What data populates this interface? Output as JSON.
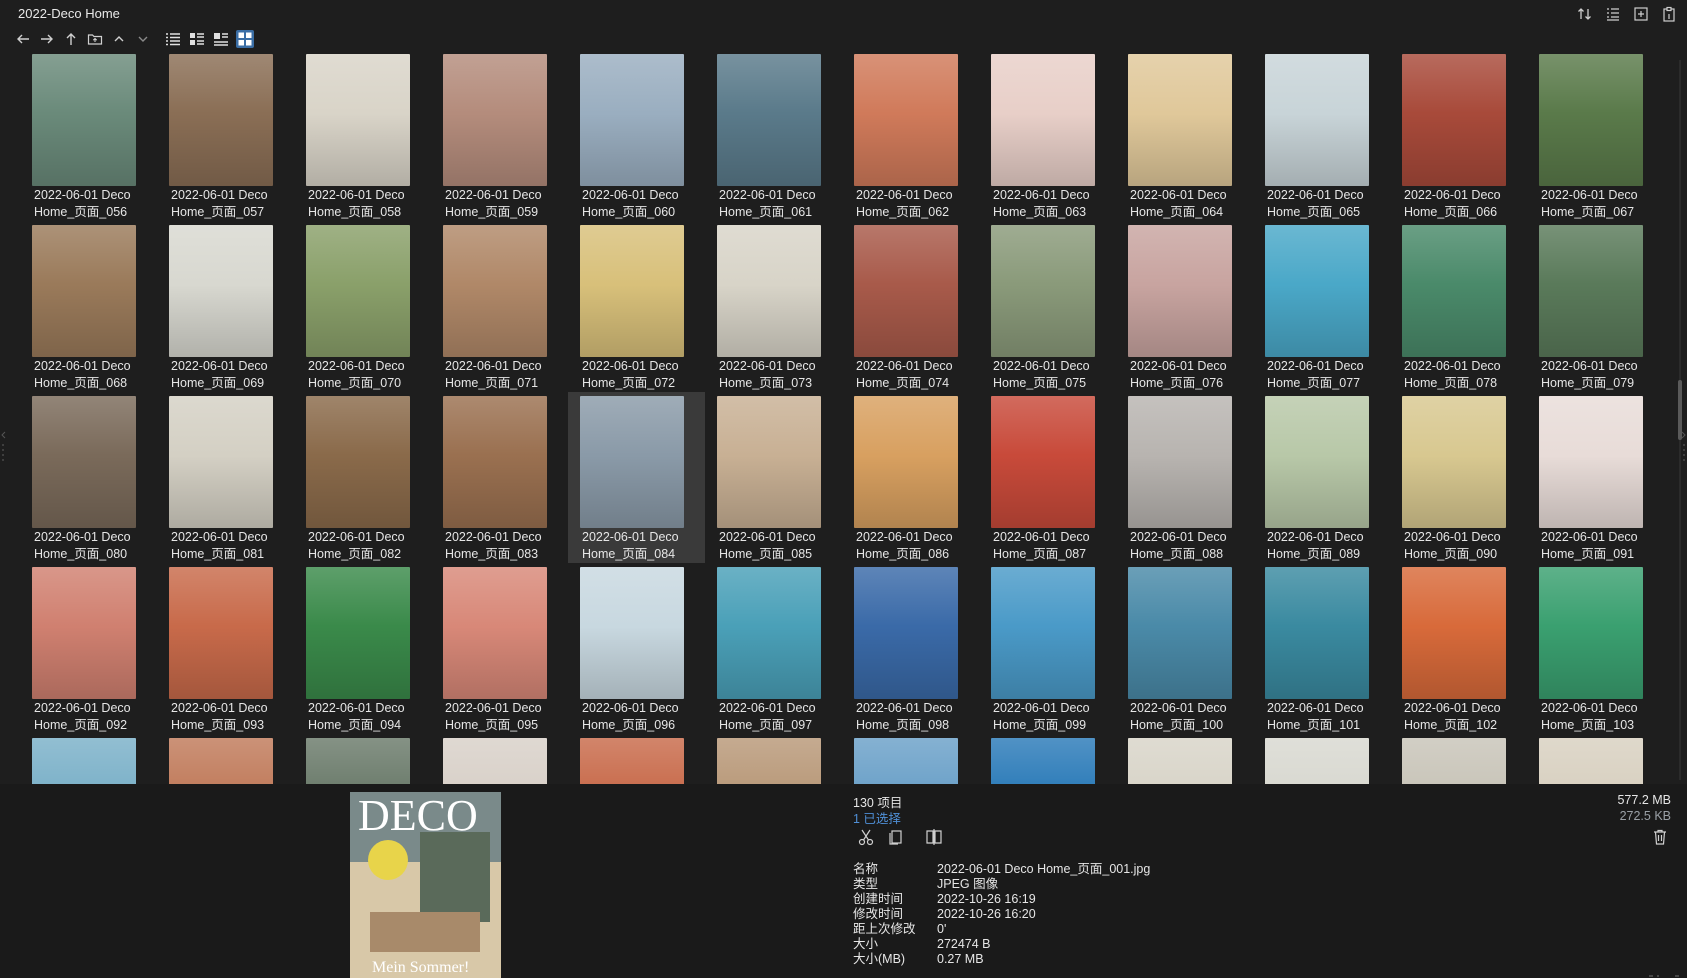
{
  "window": {
    "title": "2022-Deco Home"
  },
  "toolbar": {
    "buttons": [
      {
        "name": "back-icon"
      },
      {
        "name": "forward-icon"
      },
      {
        "name": "up-icon"
      },
      {
        "name": "folder-up-icon"
      },
      {
        "name": "chevron-up-icon"
      },
      {
        "name": "chevron-down-icon"
      },
      {
        "name": "view-list-icon"
      },
      {
        "name": "view-details-icon"
      },
      {
        "name": "view-tiles-icon"
      },
      {
        "name": "view-thumbnails-icon"
      }
    ],
    "active_view": "view-thumbnails-icon"
  },
  "top_right": {
    "icons": [
      "sort-icon",
      "columns-icon",
      "add-pane-icon",
      "clipboard-icon"
    ]
  },
  "grid": {
    "items": [
      {
        "line1": "2022-06-01 Deco",
        "line2": "Home_页面_056",
        "color": "#6a8a7a"
      },
      {
        "line1": "2022-06-01 Deco",
        "line2": "Home_页面_057",
        "color": "#8a6e55"
      },
      {
        "line1": "2022-06-01 Deco",
        "line2": "Home_页面_058",
        "color": "#d9d4c8"
      },
      {
        "line1": "2022-06-01 Deco",
        "line2": "Home_页面_059",
        "color": "#b48c7c"
      },
      {
        "line1": "2022-06-01 Deco",
        "line2": "Home_页面_060",
        "color": "#9aaec0"
      },
      {
        "line1": "2022-06-01 Deco",
        "line2": "Home_页面_061",
        "color": "#5a7a8a"
      },
      {
        "line1": "2022-06-01 Deco",
        "line2": "Home_页面_062",
        "color": "#d07a5a"
      },
      {
        "line1": "2022-06-01 Deco",
        "line2": "Home_页面_063",
        "color": "#e8cfc8"
      },
      {
        "line1": "2022-06-01 Deco",
        "line2": "Home_页面_064",
        "color": "#e0c89a"
      },
      {
        "line1": "2022-06-01 Deco",
        "line2": "Home_页面_065",
        "color": "#c8d4d8"
      },
      {
        "line1": "2022-06-01 Deco",
        "line2": "Home_页面_066",
        "color": "#a84a3a"
      },
      {
        "line1": "2022-06-01 Deco",
        "line2": "Home_页面_067",
        "color": "#5a7a4a"
      },
      {
        "line1": "2022-06-01 Deco",
        "line2": "Home_页面_068",
        "color": "#9a7a5a"
      },
      {
        "line1": "2022-06-01 Deco",
        "line2": "Home_页面_069",
        "color": "#d8d8d0"
      },
      {
        "line1": "2022-06-01 Deco",
        "line2": "Home_页面_070",
        "color": "#8aa06a"
      },
      {
        "line1": "2022-06-01 Deco",
        "line2": "Home_页面_071",
        "color": "#b08868"
      },
      {
        "line1": "2022-06-01 Deco",
        "line2": "Home_页面_072",
        "color": "#d8c07a"
      },
      {
        "line1": "2022-06-01 Deco",
        "line2": "Home_页面_073",
        "color": "#d8d4c8"
      },
      {
        "line1": "2022-06-01 Deco",
        "line2": "Home_页面_074",
        "color": "#a85a4a"
      },
      {
        "line1": "2022-06-01 Deco",
        "line2": "Home_页面_075",
        "color": "#8a9a7a"
      },
      {
        "line1": "2022-06-01 Deco",
        "line2": "Home_页面_076",
        "color": "#c8a4a0"
      },
      {
        "line1": "2022-06-01 Deco",
        "line2": "Home_页面_077",
        "color": "#4aa8c8"
      },
      {
        "line1": "2022-06-01 Deco",
        "line2": "Home_页面_078",
        "color": "#4a8a6a"
      },
      {
        "line1": "2022-06-01 Deco",
        "line2": "Home_页面_079",
        "color": "#5a7a5a"
      },
      {
        "line1": "2022-06-01 Deco",
        "line2": "Home_页面_080",
        "color": "#7a6a5a"
      },
      {
        "line1": "2022-06-01 Deco",
        "line2": "Home_页面_081",
        "color": "#d4d0c4"
      },
      {
        "line1": "2022-06-01 Deco",
        "line2": "Home_页面_082",
        "color": "#8a6a4a"
      },
      {
        "line1": "2022-06-01 Deco",
        "line2": "Home_页面_083",
        "color": "#9a7050"
      },
      {
        "line1": "2022-06-01 Deco",
        "line2": "Home_页面_084",
        "color": "#8a9aa8"
      },
      {
        "line1": "2022-06-01 Deco",
        "line2": "Home_页面_085",
        "color": "#c8b094"
      },
      {
        "line1": "2022-06-01 Deco",
        "line2": "Home_页面_086",
        "color": "#d8a060"
      },
      {
        "line1": "2022-06-01 Deco",
        "line2": "Home_页面_087",
        "color": "#c84a3a"
      },
      {
        "line1": "2022-06-01 Deco",
        "line2": "Home_页面_088",
        "color": "#b8b4b0"
      },
      {
        "line1": "2022-06-01 Deco",
        "line2": "Home_页面_089",
        "color": "#b8c8a8"
      },
      {
        "line1": "2022-06-01 Deco",
        "line2": "Home_页面_090",
        "color": "#d8c890"
      },
      {
        "line1": "2022-06-01 Deco",
        "line2": "Home_页面_091",
        "color": "#e8dcd8"
      },
      {
        "line1": "2022-06-01 Deco",
        "line2": "Home_页面_092",
        "color": "#d08070"
      },
      {
        "line1": "2022-06-01 Deco",
        "line2": "Home_页面_093",
        "color": "#c86a4a"
      },
      {
        "line1": "2022-06-01 Deco",
        "line2": "Home_页面_094",
        "color": "#3a8a4a"
      },
      {
        "line1": "2022-06-01 Deco",
        "line2": "Home_页面_095",
        "color": "#d88878"
      },
      {
        "line1": "2022-06-01 Deco",
        "line2": "Home_页面_096",
        "color": "#c8d8e0"
      },
      {
        "line1": "2022-06-01 Deco",
        "line2": "Home_页面_097",
        "color": "#4aa0b8"
      },
      {
        "line1": "2022-06-01 Deco",
        "line2": "Home_页面_098",
        "color": "#3a6aa8"
      },
      {
        "line1": "2022-06-01 Deco",
        "line2": "Home_页面_099",
        "color": "#4a9ac8"
      },
      {
        "line1": "2022-06-01 Deco",
        "line2": "Home_页面_100",
        "color": "#4a8aa8"
      },
      {
        "line1": "2022-06-01 Deco",
        "line2": "Home_页面_101",
        "color": "#3a8aa0"
      },
      {
        "line1": "2022-06-01 Deco",
        "line2": "Home_页面_102",
        "color": "#d86a3a"
      },
      {
        "line1": "2022-06-01 Deco",
        "line2": "Home_页面_103",
        "color": "#3aa070"
      },
      {
        "line1": "",
        "line2": "",
        "color": "#7ab0c8"
      },
      {
        "line1": "",
        "line2": "",
        "color": "#c07a5a"
      },
      {
        "line1": "",
        "line2": "",
        "color": "#6a7a6a"
      },
      {
        "line1": "",
        "line2": "",
        "color": "#d8d0c8"
      },
      {
        "line1": "",
        "line2": "",
        "color": "#c86a4a"
      },
      {
        "line1": "",
        "line2": "",
        "color": "#b89878"
      },
      {
        "line1": "",
        "line2": "",
        "color": "#6aa0c8"
      },
      {
        "line1": "",
        "line2": "",
        "color": "#2a7ab8"
      },
      {
        "line1": "",
        "line2": "",
        "color": "#d8d4c8"
      },
      {
        "line1": "",
        "line2": "",
        "color": "#d8d8d0"
      },
      {
        "line1": "",
        "line2": "",
        "color": "#c8c4b8"
      },
      {
        "line1": "",
        "line2": "",
        "color": "#d8d0c0"
      }
    ],
    "selected_index": 28
  },
  "status": {
    "count": "130 项目",
    "selected": "1 已选择",
    "total_size": "577.2 MB",
    "selected_size": "272.5 KB"
  },
  "actions": [
    "cut-icon",
    "copy-icon",
    "compare-icon"
  ],
  "properties": [
    {
      "label": "名称",
      "value": "2022-06-01 Deco Home_页面_001.jpg"
    },
    {
      "label": "类型",
      "value": "JPEG 图像"
    },
    {
      "label": "创建时间",
      "value": "2022-10-26  16:19"
    },
    {
      "label": "修改时间",
      "value": "2022-10-26  16:20"
    },
    {
      "label": "距上次修改",
      "value": "0'"
    },
    {
      "label": "大小",
      "value": "272474 B"
    },
    {
      "label": "大小(MB)",
      "value": "0.27 MB"
    }
  ],
  "preview": {
    "masthead": "DECO",
    "cover_line": "Mein Sommer!",
    "colors": {
      "sky": "#7a8a8a",
      "wall": "#d8c8a8",
      "accent": "#e8d44a"
    }
  }
}
